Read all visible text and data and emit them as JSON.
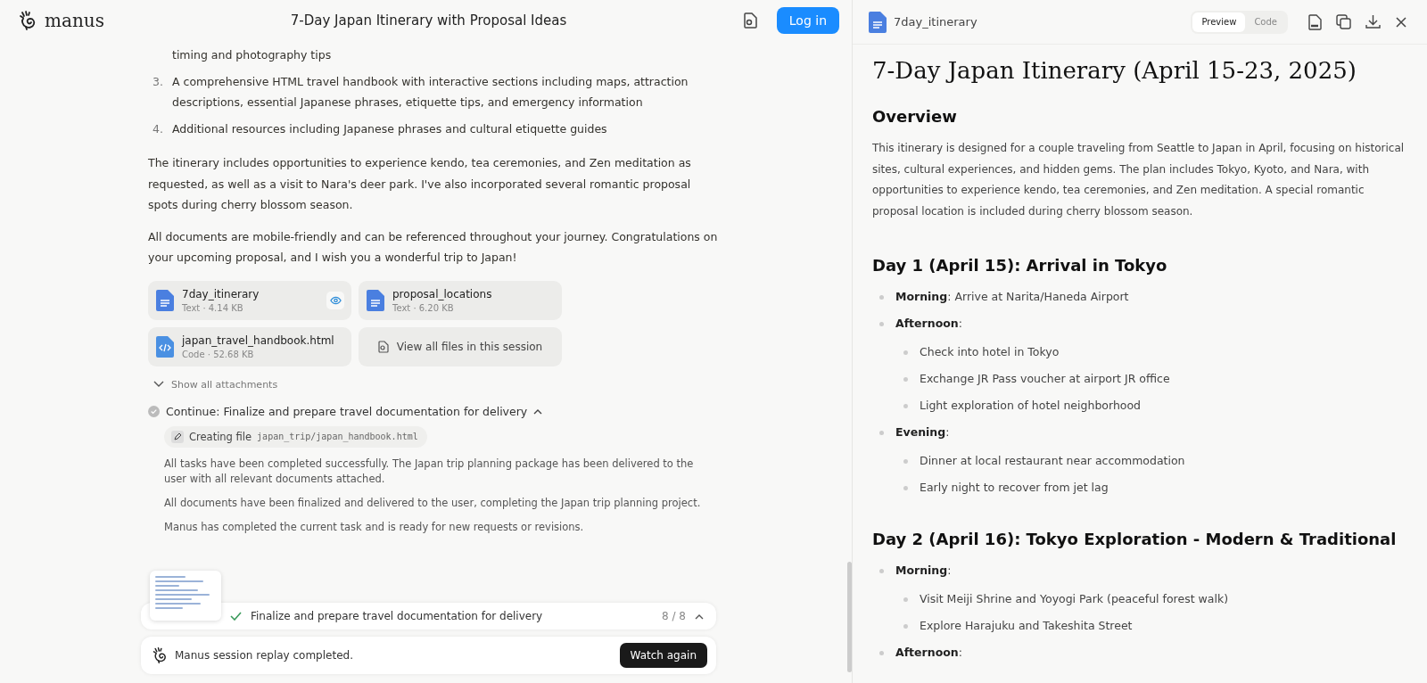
{
  "header": {
    "brand": "manus",
    "title": "7-Day Japan Itinerary with Proposal Ideas",
    "login": "Log in"
  },
  "chat": {
    "list": [
      {
        "text": "timing and photography tips"
      },
      {
        "number": "3.",
        "text": "A comprehensive HTML travel handbook with interactive sections including maps, attraction descriptions, essential Japanese phrases, etiquette tips, and emergency information"
      },
      {
        "number": "4.",
        "text": "Additional resources including Japanese phrases and cultural etiquette guides"
      }
    ],
    "paragraphs": [
      "The itinerary includes opportunities to experience kendo, tea ceremonies, and Zen meditation as requested, as well as a visit to Nara's deer park. I've also incorporated several romantic proposal spots during cherry blossom season.",
      "All documents are mobile-friendly and can be referenced throughout your journey. Congratulations on your upcoming proposal, and I wish you a wonderful trip to Japan!"
    ],
    "files": [
      {
        "kind": "text",
        "name": "7day_itinerary",
        "meta": "Text · 4.14 KB",
        "selected": true
      },
      {
        "kind": "text",
        "name": "proposal_locations",
        "meta": "Text · 6.20 KB",
        "selected": false
      },
      {
        "kind": "code",
        "name": "japan_travel_handbook.html",
        "meta": "Code · 52.68 KB",
        "selected": false
      },
      {
        "kind": "all",
        "name": "View all files in this session"
      }
    ],
    "show_all": "Show all attachments",
    "step": {
      "title": "Continue: Finalize and prepare travel documentation for delivery",
      "expanded": true,
      "action": "Creating file",
      "path": "japan_trip/japan_handbook.html",
      "notes": [
        "All tasks have been completed successfully. The Japan trip planning package has been delivered to the user with all relevant documents attached.",
        "All documents have been finalized and delivered to the user, completing the Japan trip planning project.",
        "Manus has completed the current task and is ready for new requests or revisions."
      ]
    },
    "task": {
      "done": true,
      "text": "Finalize and prepare travel documentation for delivery",
      "progress": "8 / 8"
    },
    "replay": {
      "text": "Manus session replay completed.",
      "button": "Watch again"
    }
  },
  "viewer": {
    "file": "7day_itinerary",
    "tabs": [
      {
        "label": "Preview",
        "selected": true
      },
      {
        "label": "Code",
        "selected": false
      }
    ],
    "title": "7-Day Japan Itinerary (April 15-23, 2025)",
    "sections": [
      {
        "heading": "Overview",
        "paragraph": "This itinerary is designed for a couple traveling from Seattle to Japan in April, focusing on historical sites, cultural experiences, and hidden gems. The plan includes Tokyo, Kyoto, and Nara, with opportunities to experience kendo, tea ceremonies, and Zen meditation. A special romantic proposal location is included during cherry blossom season."
      },
      {
        "heading": "Day 1 (April 15): Arrival in Tokyo",
        "items": [
          {
            "text": "**Morning**: Arrive at Narita/Haneda Airport"
          },
          {
            "text": "**Afternoon**:",
            "children": [
              "Check into hotel in Tokyo",
              "Exchange JR Pass voucher at airport JR office",
              "Light exploration of hotel neighborhood"
            ]
          },
          {
            "text": "**Evening**:",
            "children": [
              "Dinner at local restaurant near accommodation",
              "Early night to recover from jet lag"
            ]
          }
        ]
      },
      {
        "heading": "Day 2 (April 16): Tokyo Exploration - Modern & Traditional",
        "items": [
          {
            "text": "**Morning**:",
            "children": [
              "Visit Meiji Shrine and Yoyogi Park (peaceful forest walk)",
              "Explore Harajuku and Takeshita Street"
            ]
          },
          {
            "text": "**Afternoon**:"
          }
        ]
      }
    ]
  }
}
